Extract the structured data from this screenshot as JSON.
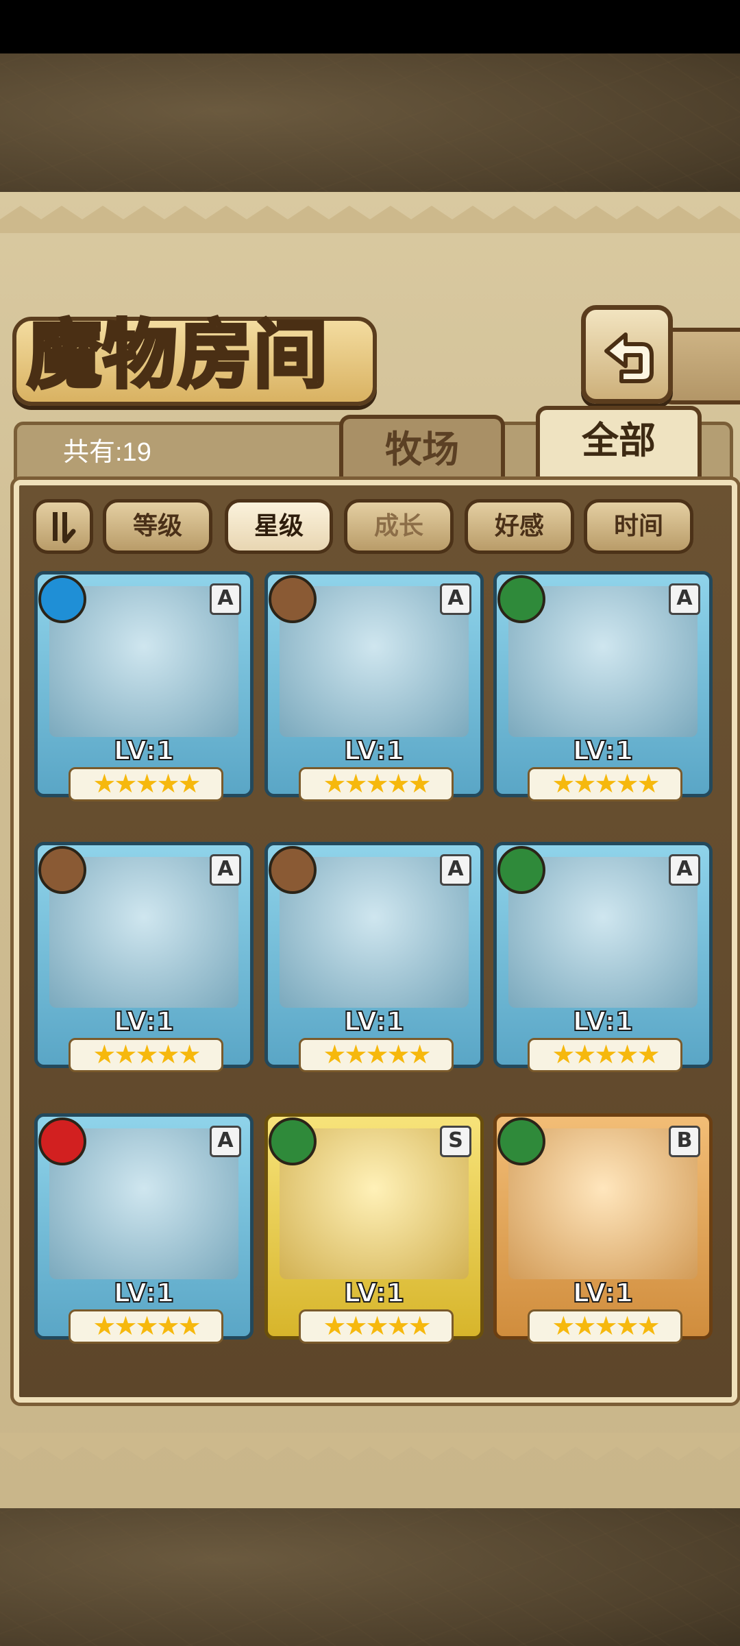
{
  "title": "魔物房间",
  "count_text": "共有:19",
  "tabs": [
    {
      "label": "牧场",
      "active": false
    },
    {
      "label": "全部",
      "active": true
    }
  ],
  "sort_buttons": [
    {
      "label": "等级",
      "active": false
    },
    {
      "label": "星级",
      "active": true
    },
    {
      "label": "成长",
      "active": false
    },
    {
      "label": "好感",
      "active": false
    },
    {
      "label": "时间",
      "active": false
    }
  ],
  "cards": [
    {
      "rank": "A",
      "element": "water-icon",
      "level": "LV:1",
      "stars": 5,
      "element_color": "#1f8fd6"
    },
    {
      "rank": "A",
      "element": "earth-icon",
      "level": "LV:1",
      "stars": 5,
      "element_color": "#8a5a34"
    },
    {
      "rank": "A",
      "element": "leaf-icon",
      "level": "LV:1",
      "stars": 5,
      "element_color": "#2f8a3a"
    },
    {
      "rank": "A",
      "element": "earth-icon",
      "level": "LV:1",
      "stars": 5,
      "element_color": "#8a5a34"
    },
    {
      "rank": "A",
      "element": "earth-icon",
      "level": "LV:1",
      "stars": 5,
      "element_color": "#8a5a34"
    },
    {
      "rank": "A",
      "element": "leaf-icon",
      "level": "LV:1",
      "stars": 5,
      "element_color": "#2f8a3a"
    },
    {
      "rank": "A",
      "element": "fire-icon",
      "level": "LV:1",
      "stars": 5,
      "element_color": "#d22020"
    },
    {
      "rank": "S",
      "element": "leaf-icon",
      "level": "LV:1",
      "stars": 5,
      "element_color": "#2f8a3a"
    },
    {
      "rank": "B",
      "element": "leaf-icon",
      "level": "LV:1",
      "stars": 5,
      "element_color": "#2f8a3a"
    }
  ]
}
